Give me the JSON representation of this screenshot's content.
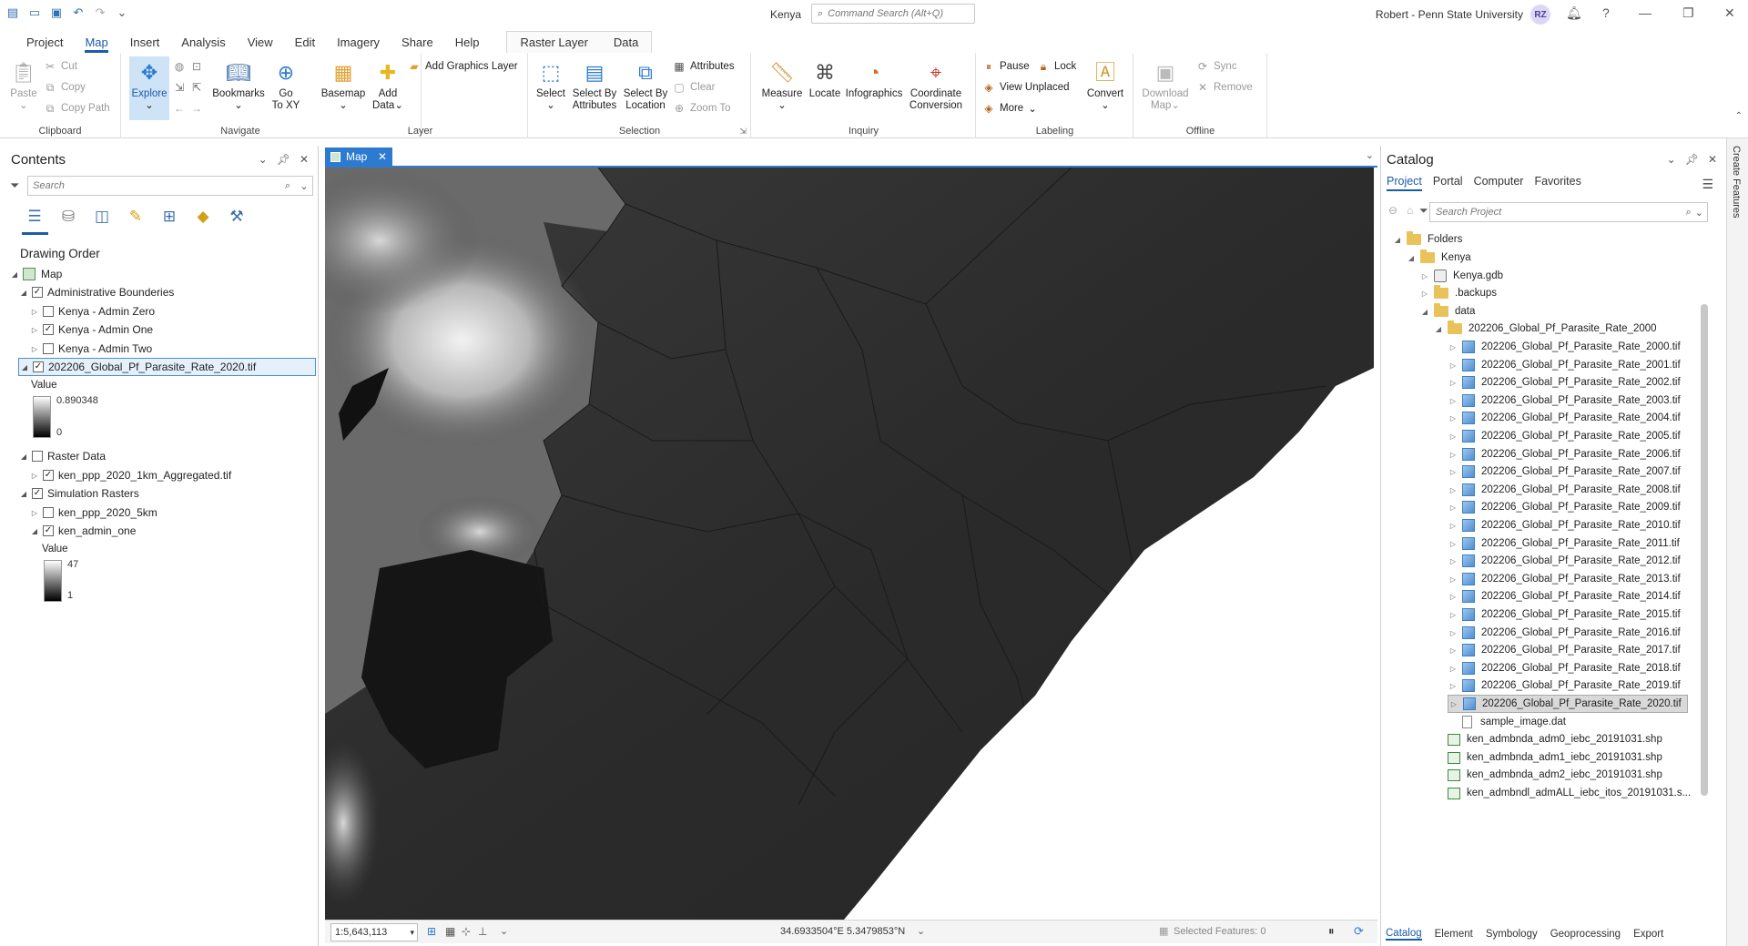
{
  "titlebar": {
    "doc_title": "Kenya",
    "command_search_placeholder": "Command Search (Alt+Q)",
    "user": "Robert - Penn State University",
    "avatar_initials": "RZ"
  },
  "tabs": [
    "Project",
    "Map",
    "Insert",
    "Analysis",
    "View",
    "Edit",
    "Imagery",
    "Share",
    "Help"
  ],
  "context_tabs": [
    "Raster Layer",
    "Data"
  ],
  "ribbon": {
    "clipboard": {
      "label": "Clipboard",
      "paste": "Paste",
      "cut": "Cut",
      "copy": "Copy",
      "copy_path": "Copy Path"
    },
    "navigate": {
      "label": "Navigate",
      "explore": "Explore",
      "bookmarks": "Bookmarks",
      "go_to_xy_1": "Go",
      "go_to_xy_2": "To XY"
    },
    "layer": {
      "label": "Layer",
      "basemap": "Basemap",
      "add_data_1": "Add",
      "add_data_2": "Data",
      "add_graphics_layer": "Add Graphics Layer"
    },
    "selection": {
      "label": "Selection",
      "select": "Select",
      "select_by_attributes_1": "Select By",
      "select_by_attributes_2": "Attributes",
      "select_by_location_1": "Select By",
      "select_by_location_2": "Location",
      "attributes": "Attributes",
      "clear": "Clear",
      "zoom_to": "Zoom To"
    },
    "inquiry": {
      "label": "Inquiry",
      "measure": "Measure",
      "locate": "Locate",
      "infographics": "Infographics",
      "coordinate_conversion_1": "Coordinate",
      "coordinate_conversion_2": "Conversion"
    },
    "labeling": {
      "label": "Labeling",
      "pause": "Pause",
      "lock": "Lock",
      "view_unplaced": "View Unplaced",
      "more": "More",
      "convert": "Convert"
    },
    "offline": {
      "label": "Offline",
      "download_map_1": "Download",
      "download_map_2": "Map",
      "sync": "Sync",
      "remove": "Remove"
    }
  },
  "contents": {
    "title": "Contents",
    "search_placeholder": "Search",
    "drawing_order": "Drawing Order",
    "layers": [
      {
        "name": "Map"
      },
      {
        "name": "Administrative Bounderies"
      },
      {
        "name": "Kenya - Admin Zero"
      },
      {
        "name": "Kenya - Admin One"
      },
      {
        "name": "Kenya - Admin Two"
      },
      {
        "name": "202206_Global_Pf_Parasite_Rate_2020.tif"
      },
      {
        "name": "Raster Data"
      },
      {
        "name": "ken_ppp_2020_1km_Aggregated.tif"
      },
      {
        "name": "Simulation Rasters"
      },
      {
        "name": "ken_ppp_2020_5km"
      },
      {
        "name": "ken_admin_one"
      }
    ],
    "legend1": {
      "title": "Value",
      "high": "0.890348",
      "low": "0"
    },
    "legend2": {
      "title": "Value",
      "high": "47",
      "low": "1"
    }
  },
  "map": {
    "tab_label": "Map",
    "scale": "1:5,643,113",
    "coordinates": "34.6933504°E 5.3479853°N",
    "selected_features": "Selected Features: 0"
  },
  "catalog": {
    "title": "Catalog",
    "tabs": [
      "Project",
      "Portal",
      "Computer",
      "Favorites"
    ],
    "search_placeholder": "Search Project",
    "items": [
      "Folders",
      "Kenya",
      "Kenya.gdb",
      ".backups",
      "data",
      "202206_Global_Pf_Parasite_Rate_2000",
      "202206_Global_Pf_Parasite_Rate_2000.tif",
      "202206_Global_Pf_Parasite_Rate_2001.tif",
      "202206_Global_Pf_Parasite_Rate_2002.tif",
      "202206_Global_Pf_Parasite_Rate_2003.tif",
      "202206_Global_Pf_Parasite_Rate_2004.tif",
      "202206_Global_Pf_Parasite_Rate_2005.tif",
      "202206_Global_Pf_Parasite_Rate_2006.tif",
      "202206_Global_Pf_Parasite_Rate_2007.tif",
      "202206_Global_Pf_Parasite_Rate_2008.tif",
      "202206_Global_Pf_Parasite_Rate_2009.tif",
      "202206_Global_Pf_Parasite_Rate_2010.tif",
      "202206_Global_Pf_Parasite_Rate_2011.tif",
      "202206_Global_Pf_Parasite_Rate_2012.tif",
      "202206_Global_Pf_Parasite_Rate_2013.tif",
      "202206_Global_Pf_Parasite_Rate_2014.tif",
      "202206_Global_Pf_Parasite_Rate_2015.tif",
      "202206_Global_Pf_Parasite_Rate_2016.tif",
      "202206_Global_Pf_Parasite_Rate_2017.tif",
      "202206_Global_Pf_Parasite_Rate_2018.tif",
      "202206_Global_Pf_Parasite_Rate_2019.tif",
      "202206_Global_Pf_Parasite_Rate_2020.tif",
      "sample_image.dat",
      "ken_admbnda_adm0_iebc_20191031.shp",
      "ken_admbnda_adm1_iebc_20191031.shp",
      "ken_admbnda_adm2_iebc_20191031.shp",
      "ken_admbndl_admALL_iebc_itos_20191031.s..."
    ],
    "bottom_tabs": [
      "Catalog",
      "Element",
      "Symbology",
      "Geoprocessing",
      "Export"
    ]
  },
  "right_strip": "Create Features"
}
